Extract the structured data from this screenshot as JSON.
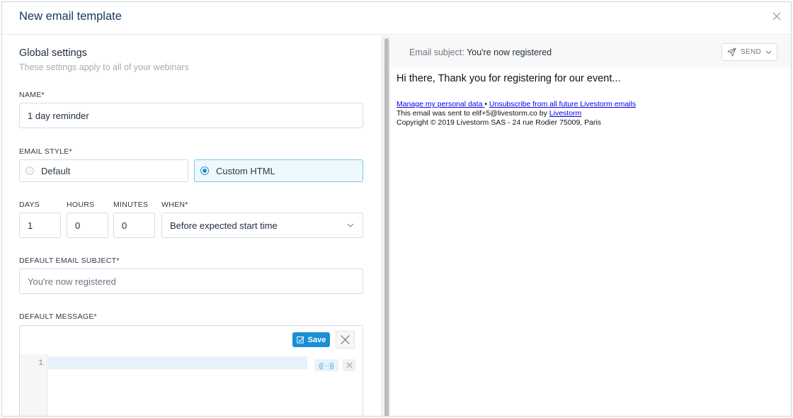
{
  "modal": {
    "title": "New email template"
  },
  "global": {
    "title": "Global settings",
    "subtitle": "These settings apply to all of your webinars"
  },
  "name": {
    "label": "NAME*",
    "value": "1 day reminder"
  },
  "email_style": {
    "label": "EMAIL STYLE*",
    "options": [
      {
        "label": "Default",
        "selected": false
      },
      {
        "label": "Custom HTML",
        "selected": true
      }
    ]
  },
  "timing": {
    "days": {
      "label": "DAYS",
      "value": "1"
    },
    "hours": {
      "label": "HOURS",
      "value": "0"
    },
    "minutes": {
      "label": "MINUTES",
      "value": "0"
    },
    "when": {
      "label": "WHEN*",
      "value": "Before expected start time"
    }
  },
  "subject": {
    "label": "DEFAULT EMAIL SUBJECT*",
    "placeholder": "You're now registered"
  },
  "message": {
    "label": "DEFAULT MESSAGE*",
    "save_label": "Save",
    "line_number": "1",
    "tag_label": "{{···}}"
  },
  "preview": {
    "subject_label": "Email subject:",
    "subject_value": "You're now registered",
    "send_label": "SEND",
    "greeting": "Hi there, Thank you for registering for our event...",
    "manage_link": "Manage my personal data ",
    "separator": " • ",
    "unsubscribe_link": "Unsubscribe from all future Livestorm emails ",
    "sent_to_text": "This email was sent to elif+5@livestorm.co by ",
    "livestorm_link": "Livestorm",
    "copyright": "Copyright © 2019 Livestorm SAS - 24 rue Rodier 75009, Paris"
  },
  "colors": {
    "accent": "#1a8fd4",
    "title": "#17365c"
  }
}
